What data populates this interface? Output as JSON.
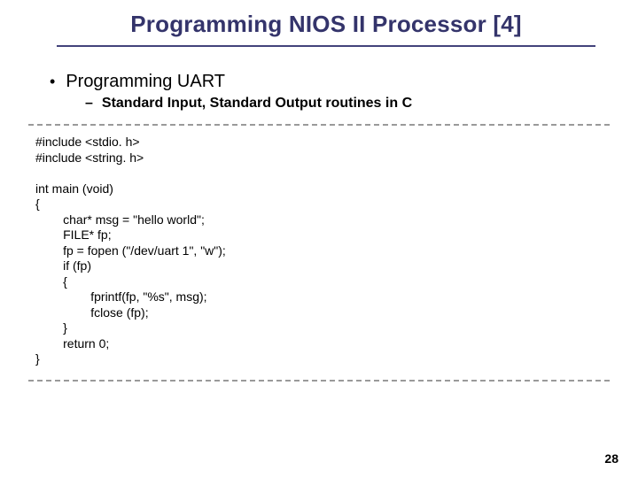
{
  "slide": {
    "title": "Programming NIOS II Processor [4]",
    "bullet": "Programming UART",
    "subbullet": "Standard Input, Standard Output routines in C",
    "code": "#include <stdio. h>\n#include <string. h>\n\nint main (void)\n{\n        char* msg = \"hello world\";\n        FILE* fp;\n        fp = fopen (\"/dev/uart 1\", \"w\");\n        if (fp)\n        {\n                fprintf(fp, \"%s\", msg);\n                fclose (fp);\n        }\n        return 0;\n}",
    "page_number": "28"
  }
}
